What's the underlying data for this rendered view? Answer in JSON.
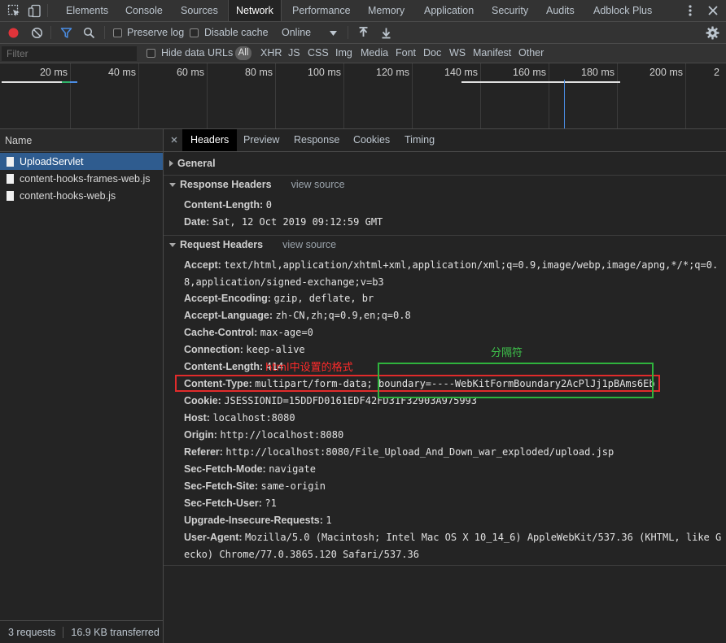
{
  "tabs": [
    "Elements",
    "Console",
    "Sources",
    "Network",
    "Performance",
    "Memory",
    "Application",
    "Security",
    "Audits",
    "Adblock Plus"
  ],
  "active_tab": "Network",
  "toolbar": {
    "preserve_log": "Preserve log",
    "disable_cache": "Disable cache",
    "throttle": "Online"
  },
  "filter": {
    "placeholder": "Filter",
    "hide_data_urls": "Hide data URLs",
    "types": [
      "All",
      "XHR",
      "JS",
      "CSS",
      "Img",
      "Media",
      "Font",
      "Doc",
      "WS",
      "Manifest",
      "Other"
    ]
  },
  "timeline": {
    "labels": [
      "20 ms",
      "40 ms",
      "60 ms",
      "80 ms",
      "100 ms",
      "120 ms",
      "140 ms",
      "160 ms",
      "180 ms",
      "200 ms",
      "2"
    ]
  },
  "requests": {
    "header": "Name",
    "items": [
      "UploadServlet",
      "content-hooks-frames-web.js",
      "content-hooks-web.js"
    ],
    "status": "3 requests",
    "transferred": "16.9 KB transferred"
  },
  "detail_tabs": [
    "Headers",
    "Preview",
    "Response",
    "Cookies",
    "Timing"
  ],
  "general": {
    "title": "General"
  },
  "response_headers": {
    "title": "Response Headers",
    "view_source": "view source",
    "items": [
      {
        "name": "Content-Length:",
        "value": "0"
      },
      {
        "name": "Date:",
        "value": "Sat, 12 Oct 2019 09:12:59 GMT"
      }
    ]
  },
  "request_headers": {
    "title": "Request Headers",
    "view_source": "view source",
    "accept_name": "Accept:",
    "accept_value_1": "text/html,application/xhtml+xml,application/xml;q=0.9,image/webp,image/apng,*/*;q=0.",
    "accept_value_2": "8,application/signed-exchange;v=b3",
    "items": [
      {
        "name": "Accept-Encoding:",
        "value": "gzip, deflate, br"
      },
      {
        "name": "Accept-Language:",
        "value": "zh-CN,zh;q=0.9,en;q=0.8"
      },
      {
        "name": "Cache-Control:",
        "value": "max-age=0"
      },
      {
        "name": "Connection:",
        "value": "keep-alive"
      },
      {
        "name": "Content-Length:",
        "value": "414"
      },
      {
        "name": "Content-Type:",
        "value": "multipart/form-data; boundary=----WebKitFormBoundary2AcPlJj1pBAms6Eb"
      },
      {
        "name": "Cookie:",
        "value": "JSESSIONID=15DDFD0161EDF42FD31F32903A975993"
      },
      {
        "name": "Host:",
        "value": "localhost:8080"
      },
      {
        "name": "Origin:",
        "value": "http://localhost:8080"
      },
      {
        "name": "Referer:",
        "value": "http://localhost:8080/File_Upload_And_Down_war_exploded/upload.jsp"
      },
      {
        "name": "Sec-Fetch-Mode:",
        "value": "navigate"
      },
      {
        "name": "Sec-Fetch-Site:",
        "value": "same-origin"
      },
      {
        "name": "Sec-Fetch-User:",
        "value": "?1"
      },
      {
        "name": "Upgrade-Insecure-Requests:",
        "value": "1"
      }
    ],
    "ua_name": "User-Agent:",
    "ua_value_1": "Mozilla/5.0 (Macintosh; Intel Mac OS X 10_14_6) AppleWebKit/537.36 (KHTML, like G",
    "ua_value_2": "ecko) Chrome/77.0.3865.120 Safari/537.36"
  },
  "annotations": {
    "boundary_label": "分隔符",
    "format_label": "html中设置的格式"
  },
  "colors": {
    "selected_request": "#2f5c8f",
    "record": "#e0343a",
    "filter_active": "#4b8ee5",
    "annotation_red": "#e12b2b",
    "annotation_green": "#2fb33d"
  }
}
